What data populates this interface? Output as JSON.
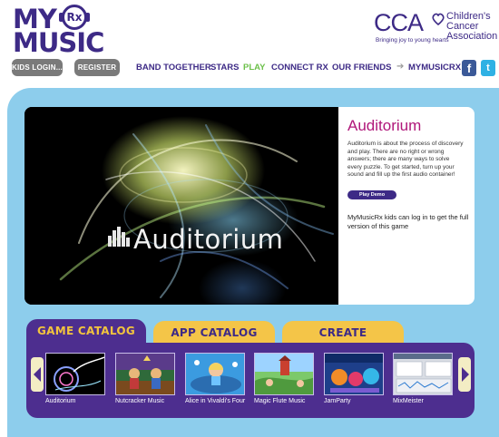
{
  "header": {
    "logo": {
      "line1": "MY",
      "line2": "MUSIC",
      "badge": "Rx"
    },
    "partner": {
      "letters": "CCA",
      "name_line1": "Children's",
      "name_line2": "Cancer",
      "name_line3": "Association",
      "tagline": "Bringing joy to young hearts"
    }
  },
  "nav": {
    "kids_login": "KIDS LOGIN...",
    "register": "REGISTER",
    "links": [
      "BAND TOGETHER",
      "STARS",
      "PLAY",
      "CONNECT RX",
      "OUR FRIENDS"
    ],
    "active_link": "PLAY",
    "mymusicrx": "MYMUSICRX",
    "facebook": "f",
    "twitter": "t"
  },
  "feature": {
    "art_title": "Auditorium",
    "title": "Auditorium",
    "description": "Auditorium is about the process of discovery and play. There are no right or wrong answers; there are many ways to solve every puzzle. To get started, turn up your sound and fill up the first audio container!",
    "play_button": "Play Demo",
    "note": "MyMusicRx kids can log in to get the full version of this game"
  },
  "tabs": [
    "GAME CATALOG",
    "APP CATALOG",
    "CREATE ANYWHERE"
  ],
  "catalog": {
    "items": [
      {
        "title": "Auditorium",
        "thumb_icon": "auditorium-thumb"
      },
      {
        "title": "Nutcracker Music",
        "thumb_icon": "nutcracker-thumb"
      },
      {
        "title": "Alice in Vivaldi's Four",
        "thumb_icon": "alice-thumb"
      },
      {
        "title": "Magic Flute Music",
        "thumb_icon": "magic-flute-thumb"
      },
      {
        "title": "JamParty",
        "thumb_icon": "jamparty-thumb"
      },
      {
        "title": "MixMeister",
        "thumb_icon": "mixmeister-thumb"
      }
    ]
  },
  "colors": {
    "brand_purple": "#3d2a86",
    "play_green": "#6cc04a",
    "frame_blue": "#8dcdec",
    "tab_yellow": "#f4c548",
    "catalog_purple": "#4d2e8f",
    "title_magenta": "#b0177a"
  }
}
